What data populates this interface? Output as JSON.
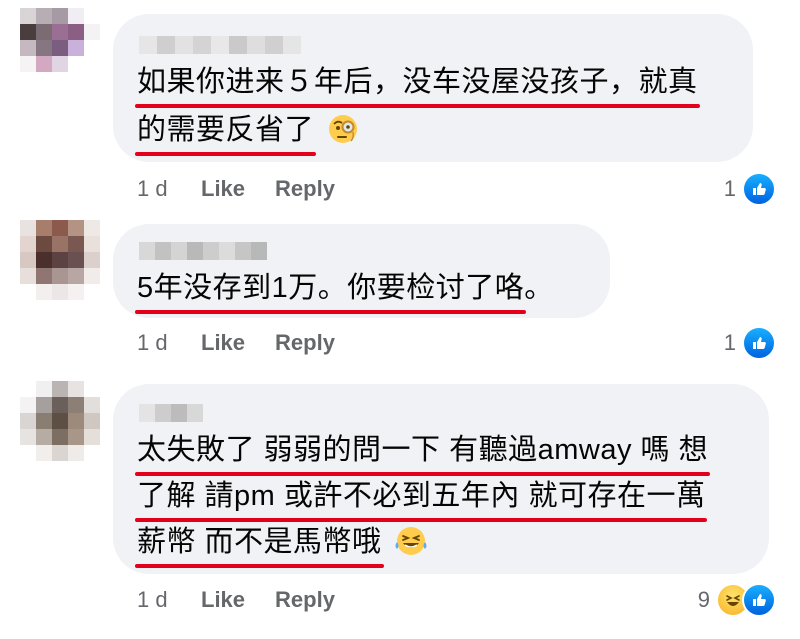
{
  "comments": [
    {
      "lines": [
        {
          "segments": [
            {
              "text": "如果你进来５年后，没车没屋没孩子，就真",
              "underline": true
            }
          ]
        },
        {
          "segments": [
            {
              "text": "的需要反省了",
              "underline": true
            }
          ],
          "emoji": "monocle-face"
        }
      ],
      "time": "1 d",
      "like_label": "Like",
      "reply_label": "Reply",
      "reaction_count": "1",
      "reactions": [
        "like"
      ]
    },
    {
      "lines": [
        {
          "segments": [
            {
              "text": "5年没存到1万。你要检讨了咯",
              "underline": true
            },
            {
              "text": "。",
              "underline": false
            }
          ]
        }
      ],
      "time": "1 d",
      "like_label": "Like",
      "reply_label": "Reply",
      "reaction_count": "1",
      "reactions": [
        "like"
      ]
    },
    {
      "lines": [
        {
          "segments": [
            {
              "text": "太失敗了 弱弱的問一下 有聽過amway 嗎 想",
              "underline": true
            }
          ]
        },
        {
          "segments": [
            {
              "text": "了解 請pm 或許不必到五年內 就可存在一萬",
              "underline": true
            }
          ]
        },
        {
          "segments": [
            {
              "text": "薪幣 而不是馬幣哦",
              "underline": true
            }
          ],
          "emoji": "laughing-tears-face"
        }
      ],
      "time": "1 d",
      "like_label": "Like",
      "reply_label": "Reply",
      "reaction_count": "9",
      "reactions": [
        "haha",
        "like"
      ]
    }
  ],
  "colors": {
    "bubble": "#f0f2f5",
    "underline": "#e3001b",
    "meta_text": "#65676b",
    "like_blue": "#0866ff"
  }
}
